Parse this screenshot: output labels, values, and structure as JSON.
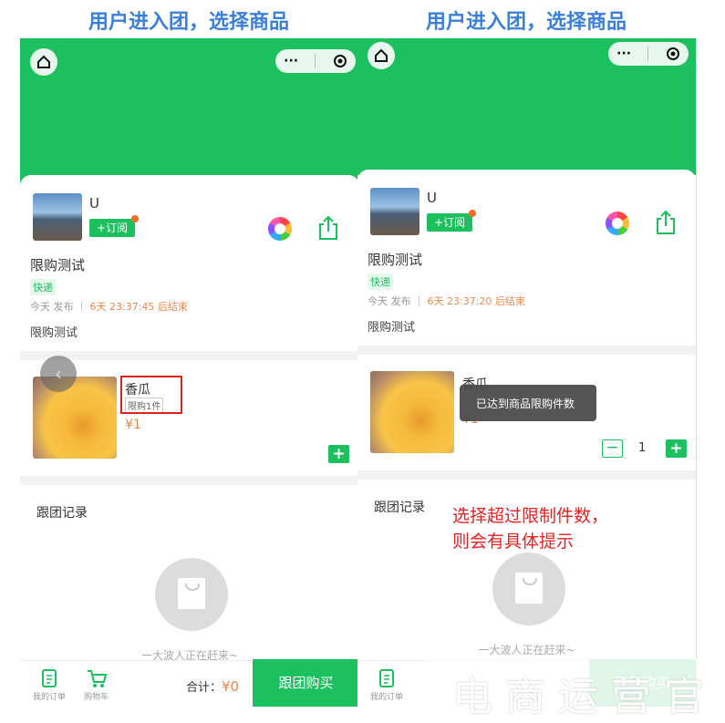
{
  "captions": [
    "用户进入团，选择商品",
    "用户进入团，选择商品"
  ],
  "header": {
    "more": "···"
  },
  "group": {
    "user": "U",
    "subscribe": "+订阅",
    "title": "限购测试",
    "delivery": "快递",
    "published": "今天 发布",
    "countdown_left": "6天 23:37:45 后结束",
    "countdown_right": "6天 23:37:20 后结束",
    "description": "限购测试"
  },
  "product": {
    "name": "香瓜",
    "limit": "限购1件",
    "price": "¥1",
    "quantity": "1",
    "add": "+",
    "remove": "−"
  },
  "toast": "已达到商品限购件数",
  "records": {
    "title": "跟团记录",
    "empty": "一大波人正在赶来~"
  },
  "bottom": {
    "orders": "我的订单",
    "cart": "购物车",
    "total_label": "合计：",
    "total_value": "¥0",
    "buy": "跟团购买"
  },
  "annotation": [
    "选择超过限制件数，",
    "则会有具体提示"
  ],
  "watermark": "电商运营官",
  "colors": {
    "brand": "#1cc05e",
    "price": "#e9884c",
    "annotation": "#e82020",
    "caption": "#3b7fd9"
  }
}
